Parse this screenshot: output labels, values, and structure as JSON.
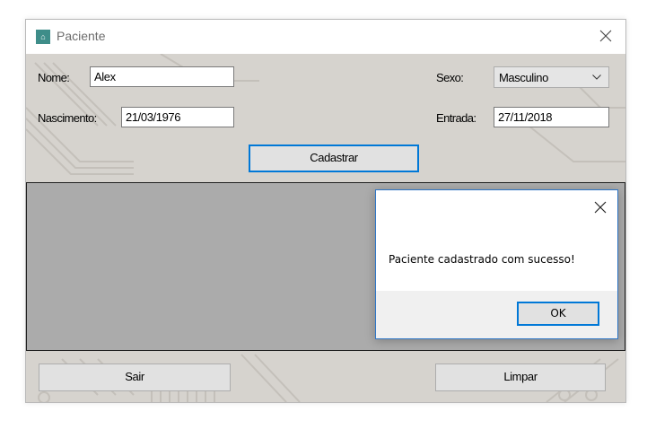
{
  "window": {
    "title": "Paciente",
    "icon": "app-icon"
  },
  "form": {
    "nome_label": "Nome:",
    "nome_value": "Alex",
    "nascimento_label": "Nascimento:",
    "nascimento_value": "21/03/1976",
    "sexo_label": "Sexo:",
    "sexo_value": "Masculino",
    "entrada_label": "Entrada:",
    "entrada_value": "27/11/2018",
    "cadastrar_label": "Cadastrar",
    "sair_label": "Sair",
    "limpar_label": "Limpar"
  },
  "dialog": {
    "message": "Paciente cadastrado com sucesso!",
    "ok_label": "OK"
  },
  "colors": {
    "accent": "#0078d7",
    "client_bg": "#d6d3ce",
    "grid_bg": "#ababab"
  }
}
